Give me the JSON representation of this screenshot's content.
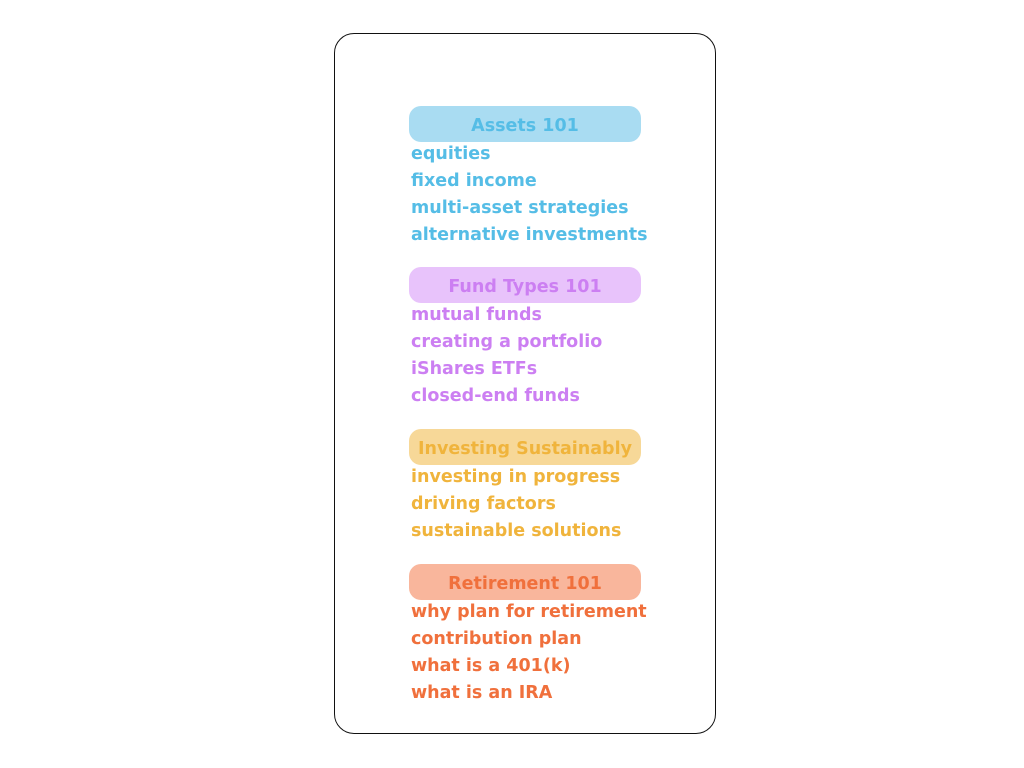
{
  "sections": [
    {
      "title": "Assets 101",
      "bg": "#a9dcf2",
      "color": "#55bde6",
      "items": [
        "equities",
        "fixed income",
        "multi-asset strategies",
        "alternative investments"
      ]
    },
    {
      "title": "Fund Types 101",
      "bg": "#e8c3fb",
      "color": "#cc7ff2",
      "items": [
        "mutual funds",
        "creating a portfolio",
        "iShares ETFs",
        "closed-end funds"
      ]
    },
    {
      "title": "Investing Sustainably",
      "bg": "#f7d898",
      "color": "#f0b43c",
      "items": [
        "investing in progress",
        "driving factors",
        "sustainable solutions"
      ]
    },
    {
      "title": "Retirement 101",
      "bg": "#f9b69c",
      "color": "#f0703c",
      "items": [
        "why plan for retirement",
        "contribution plan",
        "what is a 401(k)",
        "what is an IRA"
      ]
    }
  ]
}
